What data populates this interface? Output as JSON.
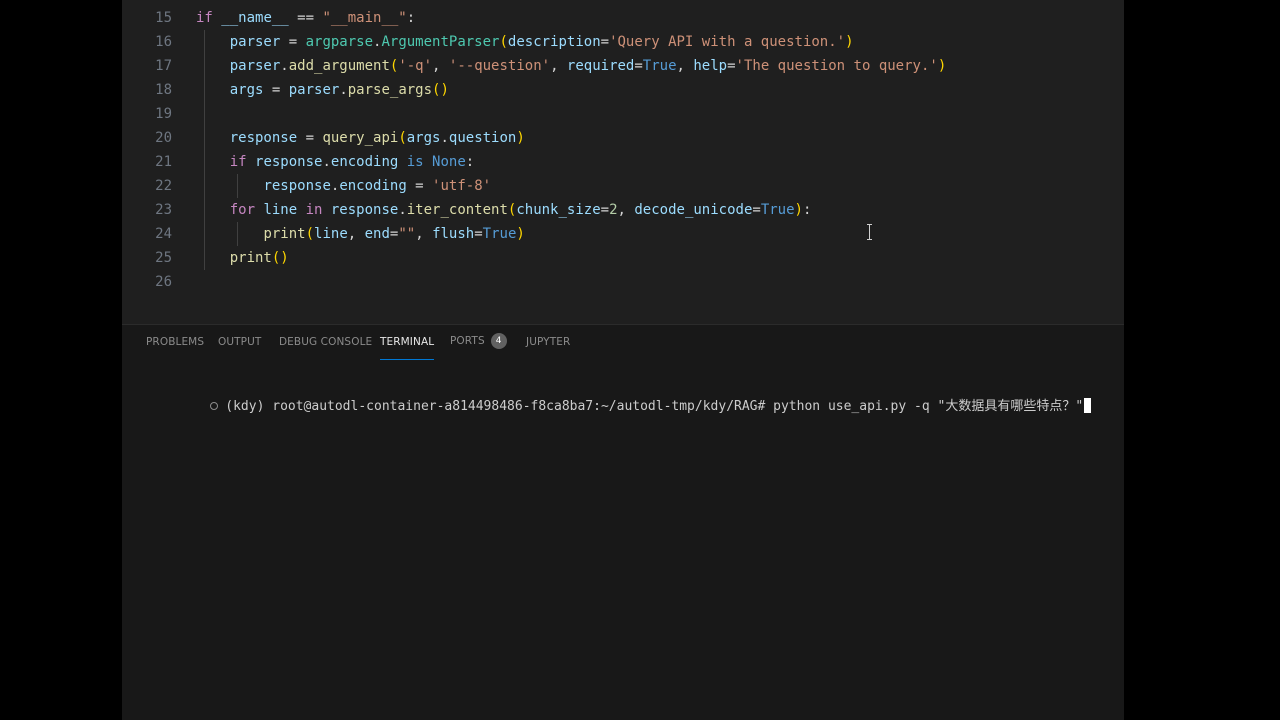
{
  "editor": {
    "lines": [
      {
        "num": "15",
        "tokens": [
          {
            "t": "if ",
            "c": "kw"
          },
          {
            "t": "__name__",
            "c": "var"
          },
          {
            "t": " == ",
            "c": "op"
          },
          {
            "t": "\"__main__\"",
            "c": "str"
          },
          {
            "t": ":",
            "c": "op"
          }
        ]
      },
      {
        "num": "16",
        "tokens": [
          {
            "t": "    "
          },
          {
            "t": "parser",
            "c": "var"
          },
          {
            "t": " = ",
            "c": "op"
          },
          {
            "t": "argparse",
            "c": "cls"
          },
          {
            "t": ".",
            "c": "op"
          },
          {
            "t": "ArgumentParser",
            "c": "cls"
          },
          {
            "t": "(",
            "c": "p1"
          },
          {
            "t": "description",
            "c": "var"
          },
          {
            "t": "=",
            "c": "op"
          },
          {
            "t": "'Query API with a question.'",
            "c": "str"
          },
          {
            "t": ")",
            "c": "p1"
          }
        ]
      },
      {
        "num": "17",
        "tokens": [
          {
            "t": "    "
          },
          {
            "t": "parser",
            "c": "var"
          },
          {
            "t": ".",
            "c": "op"
          },
          {
            "t": "add_argument",
            "c": "fn"
          },
          {
            "t": "(",
            "c": "p1"
          },
          {
            "t": "'-q'",
            "c": "str"
          },
          {
            "t": ", ",
            "c": "op"
          },
          {
            "t": "'--question'",
            "c": "str"
          },
          {
            "t": ", ",
            "c": "op"
          },
          {
            "t": "required",
            "c": "var"
          },
          {
            "t": "=",
            "c": "op"
          },
          {
            "t": "True",
            "c": "bi"
          },
          {
            "t": ", ",
            "c": "op"
          },
          {
            "t": "help",
            "c": "var"
          },
          {
            "t": "=",
            "c": "op"
          },
          {
            "t": "'The question to query.'",
            "c": "str"
          },
          {
            "t": ")",
            "c": "p1"
          }
        ]
      },
      {
        "num": "18",
        "tokens": [
          {
            "t": "    "
          },
          {
            "t": "args",
            "c": "var"
          },
          {
            "t": " = ",
            "c": "op"
          },
          {
            "t": "parser",
            "c": "var"
          },
          {
            "t": ".",
            "c": "op"
          },
          {
            "t": "parse_args",
            "c": "fn"
          },
          {
            "t": "()",
            "c": "p1"
          }
        ]
      },
      {
        "num": "19",
        "tokens": []
      },
      {
        "num": "20",
        "tokens": [
          {
            "t": "    "
          },
          {
            "t": "response",
            "c": "var"
          },
          {
            "t": " = ",
            "c": "op"
          },
          {
            "t": "query_api",
            "c": "fn"
          },
          {
            "t": "(",
            "c": "p1"
          },
          {
            "t": "args",
            "c": "var"
          },
          {
            "t": ".",
            "c": "op"
          },
          {
            "t": "question",
            "c": "var"
          },
          {
            "t": ")",
            "c": "p1"
          }
        ]
      },
      {
        "num": "21",
        "tokens": [
          {
            "t": "    "
          },
          {
            "t": "if ",
            "c": "kw"
          },
          {
            "t": "response",
            "c": "var"
          },
          {
            "t": ".",
            "c": "op"
          },
          {
            "t": "encoding",
            "c": "var"
          },
          {
            "t": " is ",
            "c": "bi"
          },
          {
            "t": "None",
            "c": "bi"
          },
          {
            "t": ":",
            "c": "op"
          }
        ]
      },
      {
        "num": "22",
        "tokens": [
          {
            "t": "        "
          },
          {
            "t": "response",
            "c": "var"
          },
          {
            "t": ".",
            "c": "op"
          },
          {
            "t": "encoding",
            "c": "var"
          },
          {
            "t": " = ",
            "c": "op"
          },
          {
            "t": "'utf-8'",
            "c": "str"
          }
        ]
      },
      {
        "num": "23",
        "tokens": [
          {
            "t": "    "
          },
          {
            "t": "for ",
            "c": "kw"
          },
          {
            "t": "line",
            "c": "var"
          },
          {
            "t": " in ",
            "c": "kw"
          },
          {
            "t": "response",
            "c": "var"
          },
          {
            "t": ".",
            "c": "op"
          },
          {
            "t": "iter_content",
            "c": "fn"
          },
          {
            "t": "(",
            "c": "p1"
          },
          {
            "t": "chunk_size",
            "c": "var"
          },
          {
            "t": "=",
            "c": "op"
          },
          {
            "t": "2",
            "c": "num"
          },
          {
            "t": ", ",
            "c": "op"
          },
          {
            "t": "decode_unicode",
            "c": "var"
          },
          {
            "t": "=",
            "c": "op"
          },
          {
            "t": "True",
            "c": "bi"
          },
          {
            "t": ")",
            "c": "p1"
          },
          {
            "t": ":",
            "c": "op"
          }
        ]
      },
      {
        "num": "24",
        "tokens": [
          {
            "t": "        "
          },
          {
            "t": "print",
            "c": "fn"
          },
          {
            "t": "(",
            "c": "p1"
          },
          {
            "t": "line",
            "c": "var"
          },
          {
            "t": ", ",
            "c": "op"
          },
          {
            "t": "end",
            "c": "var"
          },
          {
            "t": "=",
            "c": "op"
          },
          {
            "t": "\"\"",
            "c": "str"
          },
          {
            "t": ", ",
            "c": "op"
          },
          {
            "t": "flush",
            "c": "var"
          },
          {
            "t": "=",
            "c": "op"
          },
          {
            "t": "True",
            "c": "bi"
          },
          {
            "t": ")",
            "c": "p1"
          }
        ]
      },
      {
        "num": "25",
        "tokens": [
          {
            "t": "    "
          },
          {
            "t": "print",
            "c": "fn"
          },
          {
            "t": "()",
            "c": "p1"
          }
        ]
      },
      {
        "num": "26",
        "tokens": []
      }
    ]
  },
  "panel": {
    "tabs": [
      {
        "label": "PROBLEMS"
      },
      {
        "label": "OUTPUT"
      },
      {
        "label": "DEBUG CONSOLE"
      },
      {
        "label": "TERMINAL",
        "active": true
      },
      {
        "label": "PORTS",
        "badge": "4"
      },
      {
        "label": "JUPYTER"
      }
    ]
  },
  "terminal": {
    "prompt": "(kdy) root@autodl-container-a814498486-f8ca8ba7:~/autodl-tmp/kdy/RAG#",
    "command": " python use_api.py -q \"大数据具有哪些特点？\""
  },
  "colors": {
    "window_bg": "#1f1f1f",
    "panel_bg": "#181818",
    "accent": "#0078d4",
    "keyword": "#c586c0",
    "string": "#ce9178",
    "function": "#dcdcaa",
    "variable": "#9cdcfe",
    "builtin": "#569cd6",
    "class": "#4ec9b0"
  }
}
